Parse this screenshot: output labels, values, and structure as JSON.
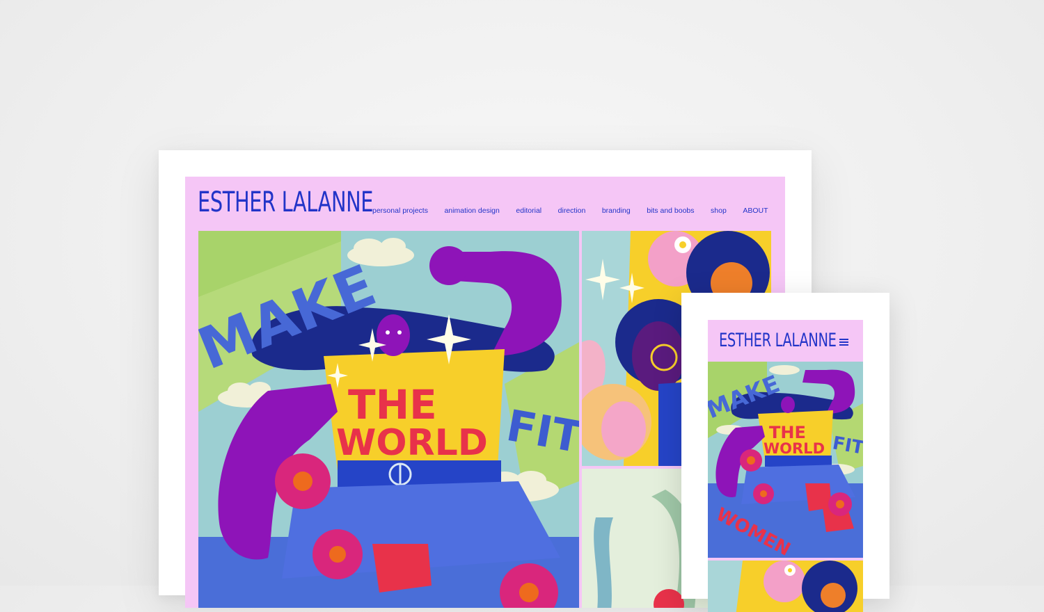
{
  "desktop": {
    "logo": "ESTHER LALANNE",
    "nav": [
      "personal projects",
      "animation design",
      "editorial",
      "direction",
      "branding",
      "bits and boobs",
      "shop",
      "ABOUT"
    ],
    "hero_art": {
      "word_make": "MAKE",
      "word_the": "THE",
      "word_world": "WORLD",
      "word_fit": "FIT"
    }
  },
  "mobile": {
    "logo": "ESTHER LALANNE",
    "menu_icon": "hamburger-icon",
    "hero_art": {
      "word_make": "MAKE",
      "word_the": "THE",
      "word_world": "WORLD",
      "word_fit": "FIT",
      "word_women": "WOMEN"
    }
  },
  "colors": {
    "site_background": "#f5c6f6",
    "brand_blue": "#2234c8",
    "purple": "#8e14b8",
    "yellow": "#f7cf2a",
    "red": "#e8324a"
  }
}
